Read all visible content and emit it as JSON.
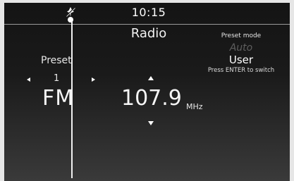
{
  "status_bar": {
    "time": "10:15",
    "icon": "pin-off-icon"
  },
  "header": {
    "title": "Radio"
  },
  "preset_mode": {
    "label": "Preset mode",
    "option_auto": "Auto",
    "option_user": "User",
    "hint": "Press ENTER to switch"
  },
  "tuner": {
    "preset_label": "Preset",
    "preset_number": "1",
    "band": "FM",
    "frequency": "107.9",
    "unit": "MHz"
  }
}
